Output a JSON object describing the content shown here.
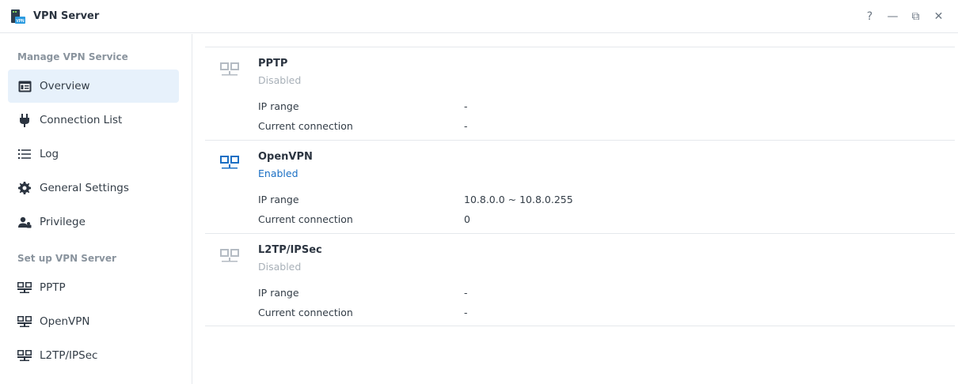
{
  "window": {
    "title": "VPN Server",
    "controls": {
      "help": "?",
      "minimize": "—",
      "restore": "⧉",
      "close": "✕"
    }
  },
  "sidebar": {
    "sections": [
      {
        "title": "Manage VPN Service"
      },
      {
        "title": "Set up VPN Server"
      }
    ],
    "items": [
      {
        "label": "Overview",
        "icon": "overview-icon",
        "active": true
      },
      {
        "label": "Connection List",
        "icon": "plug-icon"
      },
      {
        "label": "Log",
        "icon": "list-icon"
      },
      {
        "label": "General Settings",
        "icon": "gear-icon"
      },
      {
        "label": "Privilege",
        "icon": "users-icon"
      },
      {
        "label": "PPTP",
        "icon": "network-icon"
      },
      {
        "label": "OpenVPN",
        "icon": "network-icon"
      },
      {
        "label": "L2TP/IPSec",
        "icon": "network-icon"
      }
    ]
  },
  "services": [
    {
      "name": "PPTP",
      "status": "Disabled",
      "enabled": false,
      "ip_range_label": "IP range",
      "ip_range": "-",
      "connection_label": "Current connection",
      "connection": "-"
    },
    {
      "name": "OpenVPN",
      "status": "Enabled",
      "enabled": true,
      "ip_range_label": "IP range",
      "ip_range": "10.8.0.0 ~ 10.8.0.255",
      "connection_label": "Current connection",
      "connection": "0"
    },
    {
      "name": "L2TP/IPSec",
      "status": "Disabled",
      "enabled": false,
      "ip_range_label": "IP range",
      "ip_range": "-",
      "connection_label": "Current connection",
      "connection": "-"
    }
  ],
  "colors": {
    "accent": "#1a6fc4",
    "active_bg": "#e7f1fb",
    "disabled": "#a8b0b8",
    "icon_disabled": "#b4bbc3"
  }
}
